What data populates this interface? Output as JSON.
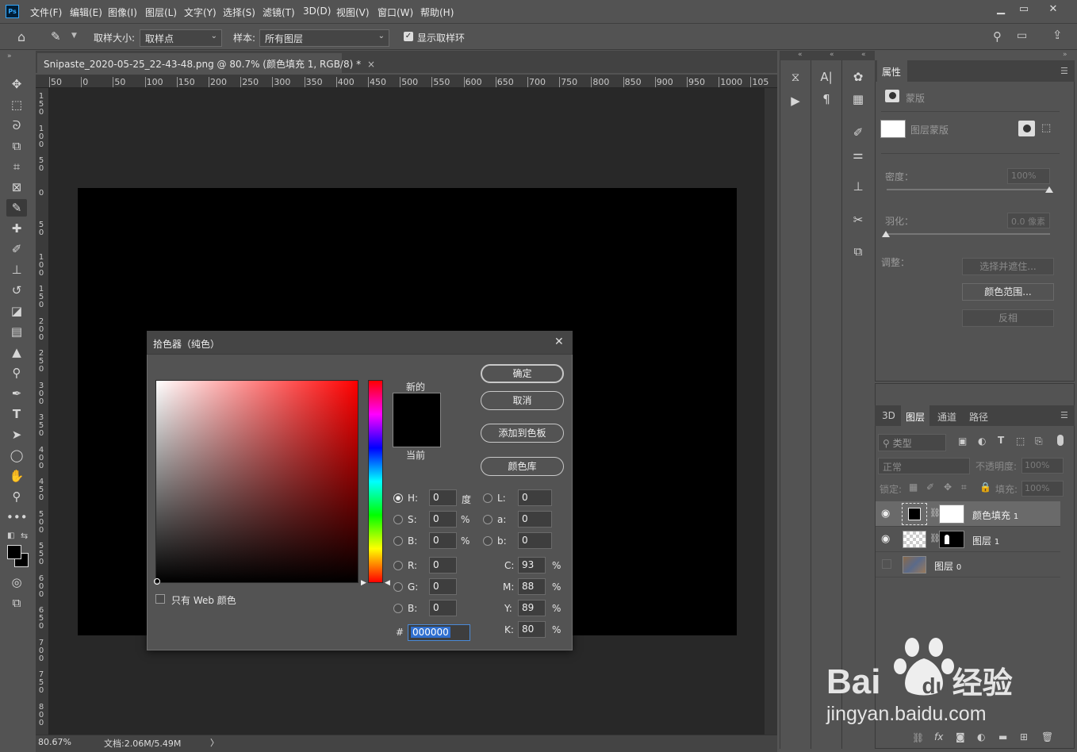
{
  "app": {
    "logo": "Ps"
  },
  "menu": [
    "文件(F)",
    "编辑(E)",
    "图像(I)",
    "图层(L)",
    "文字(Y)",
    "选择(S)",
    "滤镜(T)",
    "3D(D)",
    "视图(V)",
    "窗口(W)",
    "帮助(H)"
  ],
  "options": {
    "sample_size_label": "取样大小:",
    "sample_size_value": "取样点",
    "sample_label": "样本:",
    "sample_value": "所有图层",
    "show_ring_label": "显示取样环"
  },
  "document": {
    "tab_title": "Snipaste_2020-05-25_22-43-48.png @ 80.7% (颜色填充 1, RGB/8) *",
    "tab_close": "×",
    "image_color": "#000000"
  },
  "ruler_h": [
    "50",
    "0",
    "50",
    "100",
    "150",
    "200",
    "250",
    "300",
    "350",
    "400",
    "450",
    "500",
    "550",
    "600",
    "650",
    "700",
    "750",
    "800",
    "850",
    "900",
    "950",
    "1000",
    "105"
  ],
  "ruler_v": [
    "1 5 0",
    "1 0 0",
    "5 0",
    "0",
    "5 0",
    "1 0 0",
    "1 5 0",
    "2 0 0",
    "2 5 0",
    "3 0 0",
    "3 5 0",
    "4 0 0",
    "4 5 0",
    "5 0 0",
    "5 5 0",
    "6 0 0",
    "6 5 0",
    "7 0 0",
    "7 5 0",
    "8 0 0"
  ],
  "status": {
    "zoom": "80.67%",
    "doc": "文档:2.06M/5.49M",
    "arrow": "〉"
  },
  "dialog": {
    "title": "拾色器（纯色）",
    "close": "✕",
    "new_label": "新的",
    "current_label": "当前",
    "new_color": "#000000",
    "current_color": "#000000",
    "buttons": {
      "ok": "确定",
      "cancel": "取消",
      "add_swatch": "添加到色板",
      "color_lib": "颜色库"
    },
    "web_only": "只有 Web 颜色",
    "fields": {
      "H": {
        "label": "H:",
        "value": "0",
        "unit": "度"
      },
      "S": {
        "label": "S:",
        "value": "0",
        "unit": "%"
      },
      "Bv": {
        "label": "B:",
        "value": "0",
        "unit": "%"
      },
      "R": {
        "label": "R:",
        "value": "0"
      },
      "G": {
        "label": "G:",
        "value": "0"
      },
      "Bc": {
        "label": "B:",
        "value": "0"
      },
      "L": {
        "label": "L:",
        "value": "0"
      },
      "a": {
        "label": "a:",
        "value": "0"
      },
      "b": {
        "label": "b:",
        "value": "0"
      },
      "C": {
        "label": "C:",
        "value": "93",
        "unit": "%"
      },
      "M": {
        "label": "M:",
        "value": "88",
        "unit": "%"
      },
      "Y": {
        "label": "Y:",
        "value": "89",
        "unit": "%"
      },
      "K": {
        "label": "K:",
        "value": "80",
        "unit": "%"
      }
    },
    "hex_label": "#",
    "hex_value": "000000"
  },
  "properties": {
    "tab": "属性",
    "mask_label": "蒙版",
    "layer_mask_label": "图层蒙版",
    "density_label": "密度：",
    "density_value": "100%",
    "feather_label": "羽化：",
    "feather_value": "0.0 像素",
    "adjust_label": "调整：",
    "select_mask": "选择并遮住...",
    "color_range": "颜色范围...",
    "invert": "反相"
  },
  "layers": {
    "tabs": [
      "3D",
      "图层",
      "通道",
      "路径"
    ],
    "filter_label": "类型",
    "blend_mode": "正常",
    "opacity_label": "不透明度:",
    "opacity_value": "100%",
    "lock_label": "锁定:",
    "fill_label": "填充:",
    "fill_value": "100%",
    "items": [
      {
        "name": "颜色填充",
        "num": "1"
      },
      {
        "name": "图层",
        "num": "1"
      },
      {
        "name": "图层",
        "num": "0"
      }
    ]
  },
  "watermark": {
    "brand": "Bai",
    "brand2": "du",
    "brand3": "经验",
    "url": "jingyan.baidu.com"
  }
}
